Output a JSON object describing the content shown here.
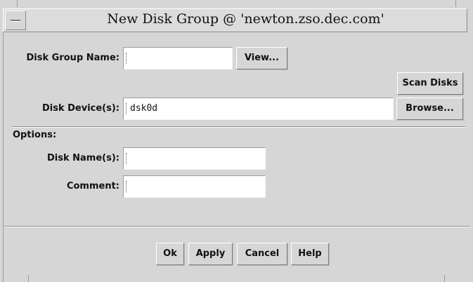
{
  "window": {
    "title": "New Disk Group @ 'newton.zso.dec.com'"
  },
  "form": {
    "disk_group_name": {
      "label": "Disk Group Name:",
      "value": ""
    },
    "view_button": "View...",
    "scan_disks_button": "Scan Disks",
    "disk_devices": {
      "label": "Disk Device(s):",
      "value": "dsk0d"
    },
    "browse_button": "Browse...",
    "options_label": "Options:",
    "disk_names": {
      "label": "Disk Name(s):",
      "value": ""
    },
    "comment": {
      "label": "Comment:",
      "value": ""
    }
  },
  "actions": {
    "ok": "Ok",
    "apply": "Apply",
    "cancel": "Cancel",
    "help": "Help"
  },
  "colors": {
    "background": "#d6d6d6",
    "field": "#ffffff"
  },
  "icons": [
    "window-menu-icon",
    "text-caret-icon"
  ]
}
